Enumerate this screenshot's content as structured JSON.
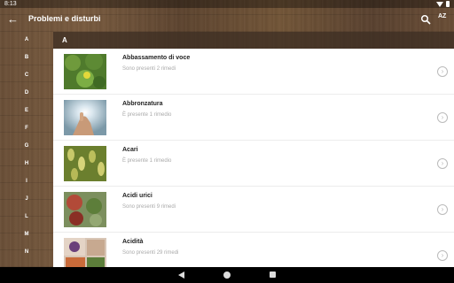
{
  "status_bar": {
    "time": "8:13"
  },
  "app_bar": {
    "title": "Problemi e disturbi",
    "sort_label": "AZ"
  },
  "alphabet": [
    "A",
    "B",
    "C",
    "D",
    "E",
    "F",
    "G",
    "H",
    "I",
    "J",
    "L",
    "M",
    "N"
  ],
  "section": {
    "letter": "A"
  },
  "items": [
    {
      "title": "Abbassamento di voce",
      "subtitle": "Sono presenti 2 rimedi"
    },
    {
      "title": "Abbronzatura",
      "subtitle": "È presente 1 rimedio"
    },
    {
      "title": "Acari",
      "subtitle": "È presente 1 rimedio"
    },
    {
      "title": "Acidi urici",
      "subtitle": "Sono presenti 9 rimedi"
    },
    {
      "title": "Acidità",
      "subtitle": "Sono presenti 29 rimedi"
    }
  ],
  "colors": {
    "app_bar_text": "#ffffff",
    "list_bg": "#ffffff",
    "subtitle": "#aaaaaa"
  },
  "icons": {
    "back": "arrow-back-icon",
    "search": "search-icon",
    "sort": "sort-az-icon",
    "row_chevron": "chevron-right-circle-icon"
  }
}
